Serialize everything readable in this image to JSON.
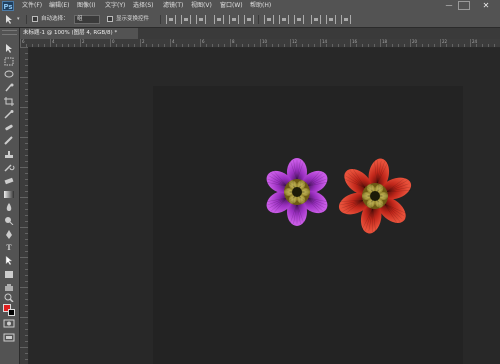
{
  "app": {
    "logo": "Ps"
  },
  "menubar": {
    "items": [
      "文件(F)",
      "编辑(E)",
      "图像(I)",
      "文字(Y)",
      "选择(S)",
      "滤镜(T)",
      "视图(V)",
      "窗口(W)",
      "帮助(H)"
    ]
  },
  "window_controls": {
    "minimize": "—",
    "close": "✕"
  },
  "options": {
    "auto_select_label": "自动选择：",
    "auto_select_value": "组",
    "transform_label": "显示变换控件"
  },
  "document_tab": {
    "label": "未标题-1 @ 100% (图层 4, RGB/8) *"
  },
  "ruler_ticks": [
    "6",
    "4",
    "2",
    "0",
    "2",
    "4",
    "6",
    "8",
    "10",
    "12",
    "14",
    "16",
    "18",
    "20",
    "22",
    "24",
    "26"
  ],
  "colors": {
    "foreground": "#e02020",
    "background": "#000000",
    "flower_purple": "#b43cd2",
    "flower_red": "#d23323",
    "flower_center": "#c8b43c"
  },
  "icons": [
    "move-icon",
    "marquee-icon",
    "lasso-icon",
    "quick-select-icon",
    "crop-icon",
    "eyedropper-icon",
    "healing-icon",
    "brush-icon",
    "clone-stamp-icon",
    "history-brush-icon",
    "eraser-icon",
    "gradient-icon",
    "blur-icon",
    "dodge-icon",
    "pen-icon",
    "type-icon",
    "path-select-icon",
    "shape-icon",
    "hand-icon",
    "zoom-icon"
  ]
}
